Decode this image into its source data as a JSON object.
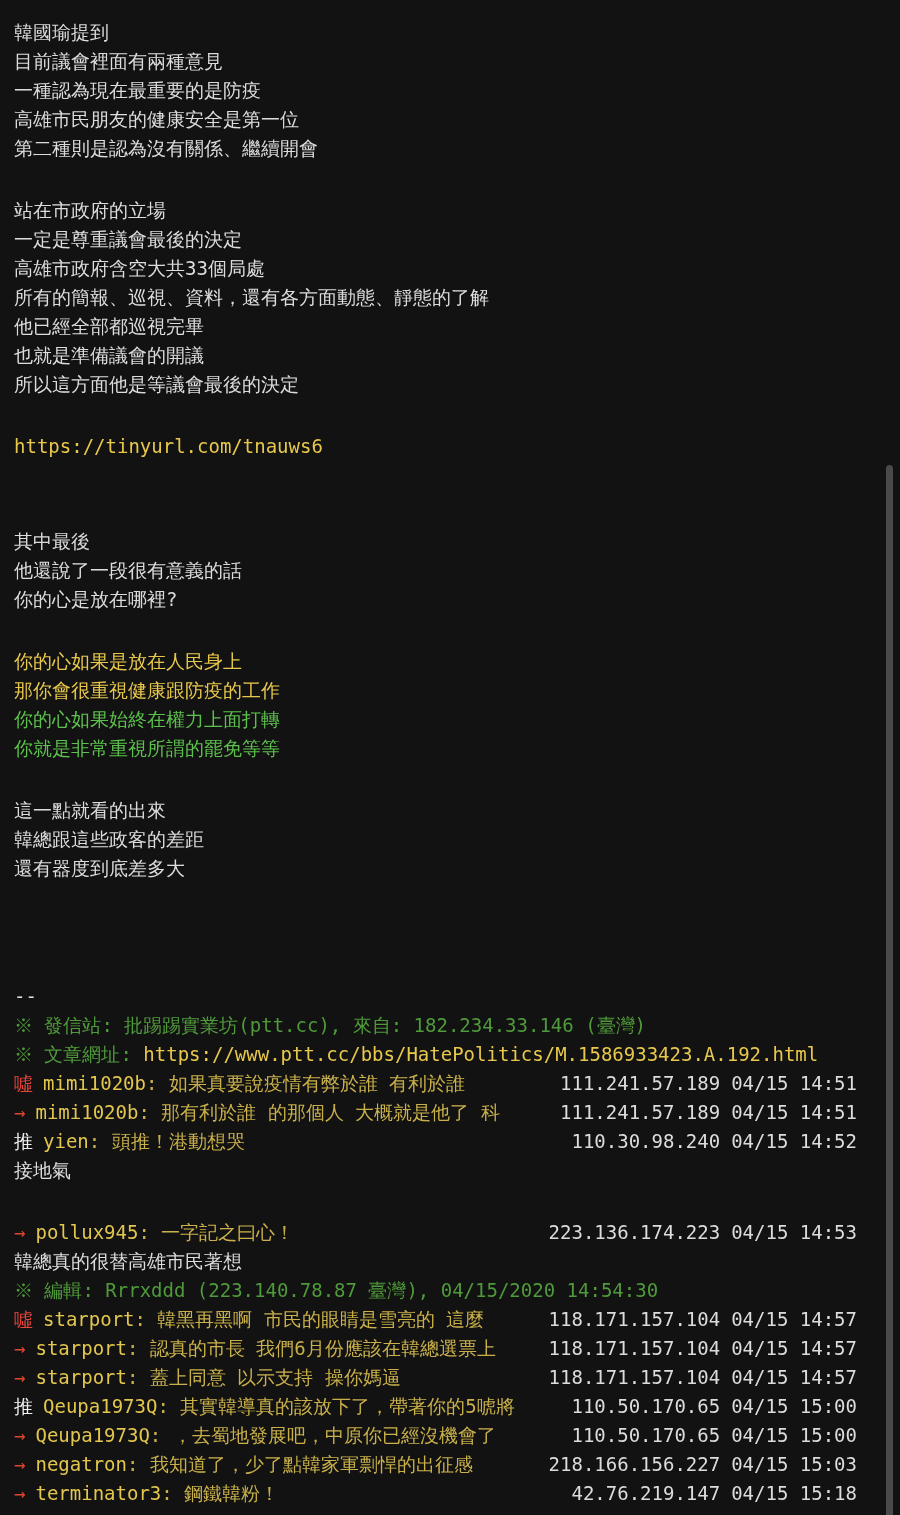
{
  "lines": [
    {
      "kind": "text",
      "text": "韓國瑜提到",
      "color": "#dcdcdc"
    },
    {
      "kind": "text",
      "text": "目前議會裡面有兩種意見",
      "color": "#dcdcdc"
    },
    {
      "kind": "text",
      "text": "一種認為現在最重要的是防疫",
      "color": "#dcdcdc"
    },
    {
      "kind": "text",
      "text": "高雄市民朋友的健康安全是第一位",
      "color": "#dcdcdc"
    },
    {
      "kind": "text",
      "text": "第二種則是認為沒有關係、繼續開會",
      "color": "#dcdcdc"
    },
    {
      "kind": "blank"
    },
    {
      "kind": "text",
      "text": "站在市政府的立場",
      "color": "#dcdcdc"
    },
    {
      "kind": "text",
      "text": "一定是尊重議會最後的決定",
      "color": "#dcdcdc"
    },
    {
      "kind": "text",
      "text": "高雄市政府含空大共33個局處",
      "color": "#dcdcdc"
    },
    {
      "kind": "text",
      "text": "所有的簡報、巡視、資料，還有各方面動態、靜態的了解",
      "color": "#dcdcdc"
    },
    {
      "kind": "text",
      "text": "他已經全部都巡視完畢",
      "color": "#dcdcdc"
    },
    {
      "kind": "text",
      "text": "也就是準備議會的開議",
      "color": "#dcdcdc"
    },
    {
      "kind": "text",
      "text": "所以這方面他是等議會最後的決定",
      "color": "#dcdcdc"
    },
    {
      "kind": "blank"
    },
    {
      "kind": "link",
      "text": "https://tinyurl.com/tnauws6"
    },
    {
      "kind": "blank"
    },
    {
      "kind": "blank"
    },
    {
      "kind": "text",
      "text": "其中最後",
      "color": "#dcdcdc"
    },
    {
      "kind": "text",
      "text": "他還說了一段很有意義的話",
      "color": "#dcdcdc"
    },
    {
      "kind": "text",
      "text": "你的心是放在哪裡?",
      "color": "#dcdcdc"
    },
    {
      "kind": "blank"
    },
    {
      "kind": "text",
      "text": "你的心如果是放在人民身上",
      "color": "#e8c84c"
    },
    {
      "kind": "text",
      "text": "那你會很重視健康跟防疫的工作",
      "color": "#e8c84c"
    },
    {
      "kind": "text",
      "text": "你的心如果始終在權力上面打轉",
      "color": "#5cc04c"
    },
    {
      "kind": "text",
      "text": "你就是非常重視所謂的罷免等等",
      "color": "#5cc04c"
    },
    {
      "kind": "blank"
    },
    {
      "kind": "text",
      "text": "這一點就看的出來",
      "color": "#dcdcdc"
    },
    {
      "kind": "text",
      "text": "韓總跟這些政客的差距",
      "color": "#dcdcdc"
    },
    {
      "kind": "text",
      "text": "還有器度到底差多大",
      "color": "#dcdcdc"
    },
    {
      "kind": "blank"
    },
    {
      "kind": "blank"
    },
    {
      "kind": "blank"
    },
    {
      "kind": "text",
      "text": "--",
      "color": "#dcdcdc"
    },
    {
      "kind": "meta",
      "text": "※ 發信站: 批踢踢實業坊(ptt.cc), 來自: 182.234.33.146 (臺灣)"
    },
    {
      "kind": "meta",
      "text": "※ 文章網址: ",
      "link": "https://www.ptt.cc/bbs/HatePolitics/M.1586933423.A.192.html"
    },
    {
      "kind": "push",
      "tag": "噓",
      "color": "#e8453a",
      "user": "mimi1020b",
      "content": ": 如果真要說疫情有弊於誰 有利於誰",
      "ip": "111.241.57.189",
      "time": "04/15 14:51"
    },
    {
      "kind": "push",
      "tag": "→",
      "color": "#e0452e",
      "user": "mimi1020b",
      "content": ": 那有利於誰 的那個人 大概就是他了 科",
      "ip": "111.241.57.189",
      "time": "04/15 14:51"
    },
    {
      "kind": "push",
      "tag": "推",
      "color": "#f0f0f0",
      "user": "yien",
      "content": ": 頭推！港動想哭",
      "ip": "110.30.98.240",
      "time": "04/15 14:52"
    },
    {
      "kind": "text",
      "text": "接地氣",
      "color": "#dcdcdc"
    },
    {
      "kind": "blank"
    },
    {
      "kind": "push",
      "tag": "→",
      "color": "#e0452e",
      "user": "pollux945",
      "content": ": 一字記之曰心！",
      "ip": "223.136.174.223",
      "time": "04/15 14:53"
    },
    {
      "kind": "text",
      "text": "韓總真的很替高雄市民著想",
      "color": "#dcdcdc"
    },
    {
      "kind": "meta",
      "text": "※ 編輯: Rrrxddd (223.140.78.87 臺灣), 04/15/2020 14:54:30"
    },
    {
      "kind": "push",
      "tag": "噓",
      "color": "#e8453a",
      "user": "starport",
      "content": ": 韓黑再黑啊 市民的眼睛是雪亮的 這麼",
      "ip": "118.171.157.104",
      "time": "04/15 14:57"
    },
    {
      "kind": "push",
      "tag": "→",
      "color": "#e0452e",
      "user": "starport",
      "content": ": 認真的市長 我們6月份應該在韓總選票上",
      "ip": "118.171.157.104",
      "time": "04/15 14:57"
    },
    {
      "kind": "push",
      "tag": "→",
      "color": "#e0452e",
      "user": "starport",
      "content": ": 蓋上同意 以示支持 操你媽逼",
      "ip": "118.171.157.104",
      "time": "04/15 14:57"
    },
    {
      "kind": "push",
      "tag": "推",
      "color": "#f0f0f0",
      "user": "Qeupa1973Q",
      "content": ": 其實韓導真的該放下了，帶著你的5唬將",
      "ip": "110.50.170.65",
      "time": "04/15 15:00"
    },
    {
      "kind": "push",
      "tag": "→",
      "color": "#e0452e",
      "user": "Qeupa1973Q",
      "content": ": ，去蜀地發展吧，中原你已經沒機會了",
      "ip": "110.50.170.65",
      "time": "04/15 15:00"
    },
    {
      "kind": "push",
      "tag": "→",
      "color": "#e0452e",
      "user": "negatron",
      "content": ": 我知道了，少了點韓家軍剽悍的出征感",
      "ip": "218.166.156.227",
      "time": "04/15 15:03"
    },
    {
      "kind": "push",
      "tag": "→",
      "color": "#e0452e",
      "user": "terminator3",
      "content": ": 鋼鐵韓粉！",
      "ip": "42.76.219.147",
      "time": "04/15 15:18"
    }
  ]
}
